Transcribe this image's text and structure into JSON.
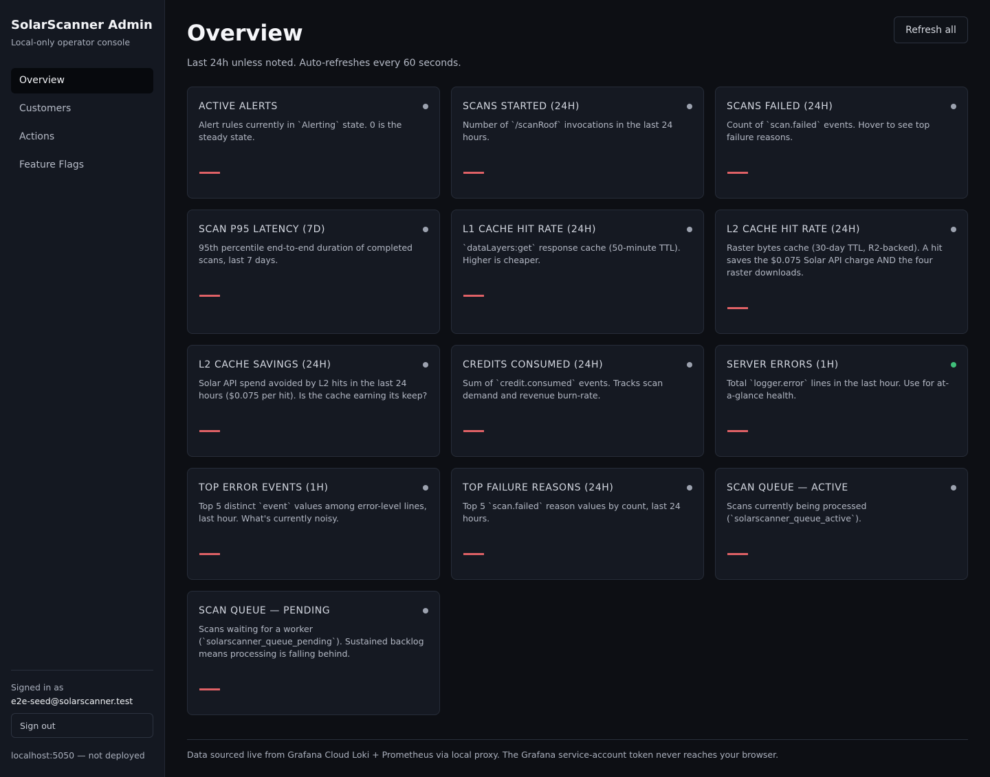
{
  "app": {
    "title": "SolarScanner Admin",
    "subtitle": "Local-only operator console"
  },
  "nav": {
    "items": [
      {
        "label": "Overview",
        "active": true
      },
      {
        "label": "Customers"
      },
      {
        "label": "Actions"
      },
      {
        "label": "Feature Flags"
      }
    ]
  },
  "session": {
    "signed_in_label": "Signed in as",
    "email": "e2e-seed@solarscanner.test",
    "sign_out_label": "Sign out",
    "environment": "localhost:5050 — not deployed"
  },
  "page": {
    "title": "Overview",
    "subtitle": "Last 24h unless noted. Auto-refreshes every 60 seconds.",
    "refresh_label": "Refresh all"
  },
  "cards": [
    {
      "title": "ACTIVE ALERTS",
      "desc": "Alert rules currently in `Alerting` state. 0 is the steady state.",
      "status": "grey"
    },
    {
      "title": "SCANS STARTED (24H)",
      "desc": "Number of `/scanRoof` invocations in the last 24 hours.",
      "status": "grey"
    },
    {
      "title": "SCANS FAILED (24H)",
      "desc": "Count of `scan.failed` events. Hover to see top failure reasons.",
      "status": "grey"
    },
    {
      "title": "SCAN P95 LATENCY (7D)",
      "desc": "95th percentile end-to-end duration of completed scans, last 7 days.",
      "status": "grey"
    },
    {
      "title": "L1 CACHE HIT RATE (24H)",
      "desc": "`dataLayers:get` response cache (50-minute TTL). Higher is cheaper.",
      "status": "grey"
    },
    {
      "title": "L2 CACHE HIT RATE (24H)",
      "desc": "Raster bytes cache (30-day TTL, R2-backed). A hit saves the $0.075 Solar API charge AND the four raster downloads.",
      "status": "grey"
    },
    {
      "title": "L2 CACHE SAVINGS (24H)",
      "desc": "Solar API spend avoided by L2 hits in the last 24 hours ($0.075 per hit). Is the cache earning its keep?",
      "status": "grey"
    },
    {
      "title": "CREDITS CONSUMED (24H)",
      "desc": "Sum of `credit.consumed` events. Tracks scan demand and revenue burn-rate.",
      "status": "grey"
    },
    {
      "title": "SERVER ERRORS (1H)",
      "desc": "Total `logger.error` lines in the last hour. Use for at-a-glance health.",
      "status": "green"
    },
    {
      "title": "TOP ERROR EVENTS (1H)",
      "desc": "Top 5 distinct `event` values among error-level lines, last hour. What's currently noisy.",
      "status": "grey"
    },
    {
      "title": "TOP FAILURE REASONS (24H)",
      "desc": "Top 5 `scan.failed` reason values by count, last 24 hours.",
      "status": "grey"
    },
    {
      "title": "SCAN QUEUE — ACTIVE",
      "desc": "Scans currently being processed (`solarscanner_queue_active`).",
      "status": "grey"
    },
    {
      "title": "SCAN QUEUE — PENDING",
      "desc": "Scans waiting for a worker (`solarscanner_queue_pending`). Sustained backlog means processing is falling behind.",
      "status": "grey"
    }
  ],
  "footer": {
    "text": "Data sourced live from Grafana Cloud Loki + Prometheus via local proxy. The Grafana service-account token never reaches your browser."
  },
  "colors": {
    "accent_value": "#e06166",
    "status_green": "#3fbf7a",
    "status_grey": "#9ca2af"
  }
}
